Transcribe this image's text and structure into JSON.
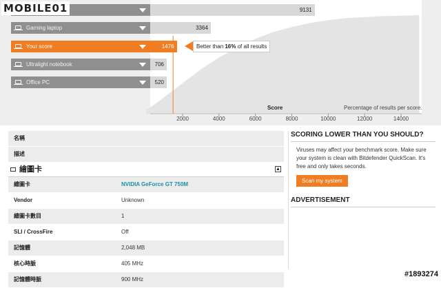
{
  "branding": {
    "logo": "MOBILE01",
    "watermark": "#1893274"
  },
  "ranking": {
    "rows": [
      {
        "label": "",
        "score": "9131",
        "active": false
      },
      {
        "label": "Gaming laptop",
        "score": "3364",
        "active": false
      },
      {
        "label": "Your score",
        "score": "1476",
        "active": true
      },
      {
        "label": "Ultralight notebook",
        "score": "706",
        "active": false
      },
      {
        "label": "Office PC",
        "score": "520",
        "active": false
      }
    ],
    "callout_prefix": "Better than ",
    "callout_pct": "16%",
    "callout_suffix": " of all results",
    "colors": {
      "active": "#f07d22",
      "inactive": "#8f8f8f",
      "bar": "#d8d8d8"
    }
  },
  "chart_data": {
    "type": "area",
    "xlabel": "Score",
    "ylabel": "Percentage of results per score.",
    "xlim": [
      0,
      15000
    ],
    "x_ticks": [
      2000,
      4000,
      6000,
      8000,
      10000,
      12000,
      14000
    ],
    "x": [
      0,
      500,
      1000,
      1500,
      2000,
      3000,
      4000,
      5000,
      6000,
      7000,
      8000,
      9000,
      10000,
      11000,
      12000,
      13000,
      14000,
      15000
    ],
    "values": [
      4,
      10,
      17,
      24,
      31,
      45,
      57,
      67,
      76,
      83,
      88,
      92,
      95,
      97,
      98,
      99,
      99.5,
      100
    ],
    "marker_x": 1476,
    "grid": false
  },
  "details": {
    "rows": [
      {
        "key": "名稱",
        "value": ""
      },
      {
        "key": "描述",
        "value": ""
      }
    ],
    "section_title": "繪圖卡",
    "section_toggle": "▲",
    "gpu_rows": [
      {
        "key": "繪圖卡",
        "value": "NVIDIA GeForce GT 750M"
      },
      {
        "key": "Vendor",
        "value": "Unknown"
      },
      {
        "key": "繪圖卡數目",
        "value": "1"
      },
      {
        "key": "SLI / CrossFire",
        "value": "Off"
      },
      {
        "key": "記憶體",
        "value": "2,048 MB"
      },
      {
        "key": "核心時脈",
        "value": "405 MHz"
      },
      {
        "key": "記憶體時脈",
        "value": "900 MHz"
      }
    ]
  },
  "sidebar": {
    "title": "SCORING LOWER THAN YOU SHOULD?",
    "body": "Viruses may affect your benchmark score. Make sure your system is clean with Bitdefender QuickScan. It's free and only takes seconds.",
    "button": "Scan my system",
    "advertisement": "ADVERTISEMENT"
  }
}
